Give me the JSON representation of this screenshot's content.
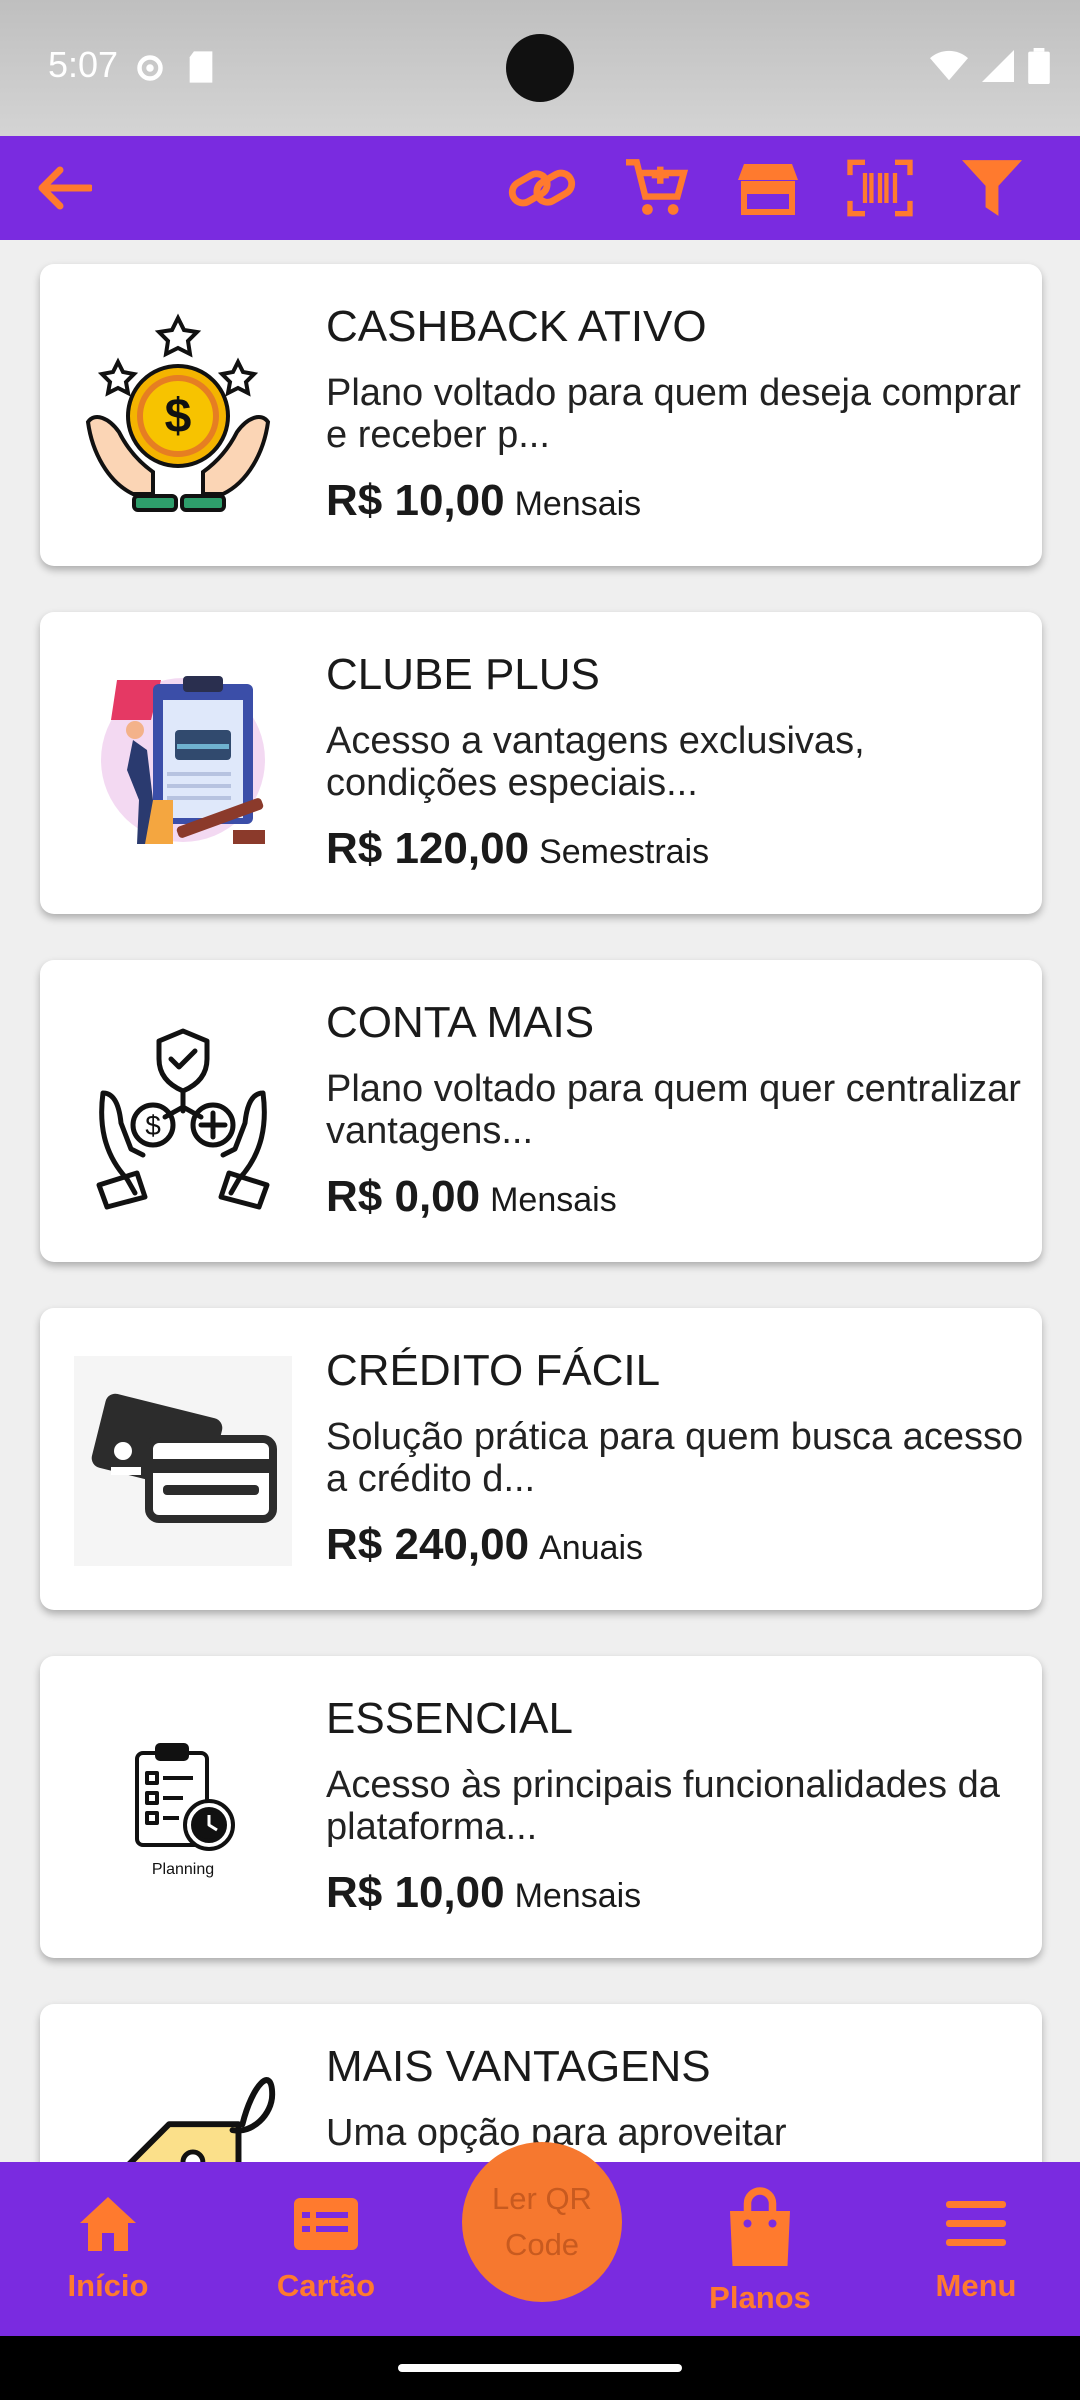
{
  "status_bar": {
    "time": "5:07"
  },
  "toolbar": {
    "back": "back-arrow-icon",
    "actions": [
      "link-icon",
      "cart-add-icon",
      "store-icon",
      "barcode-scan-icon",
      "filter-icon"
    ]
  },
  "plans": [
    {
      "title": "CASHBACK ATIVO",
      "description": "Plano voltado para quem deseja comprar e receber p...",
      "price": "R$ 10,00",
      "period": "Mensais",
      "icon": "cashback-coin-icon"
    },
    {
      "title": "CLUBE PLUS",
      "description": "Acesso a vantagens exclusivas, condições especiais...",
      "price": "R$ 120,00",
      "period": "Semestrais",
      "icon": "club-illustration-icon"
    },
    {
      "title": "CONTA MAIS",
      "description": "Plano voltado para quem quer centralizar vantagens...",
      "price": "R$ 0,00",
      "period": "Mensais",
      "icon": "hands-shield-icon"
    },
    {
      "title": "CRÉDITO FÁCIL",
      "description": "Solução prática para quem busca acesso a crédito d...",
      "price": "R$ 240,00",
      "period": "Anuais",
      "icon": "credit-cards-icon"
    },
    {
      "title": "ESSENCIAL",
      "description": "Acesso às principais funcionalidades da plataforma...",
      "price": "R$ 10,00",
      "period": "Mensais",
      "icon": "planning-clipboard-icon",
      "icon_caption": "Planning"
    },
    {
      "title": "MAIS VANTAGENS",
      "description": "Uma opção para aproveitar",
      "price": "",
      "period": "",
      "icon": "price-tag-icon"
    }
  ],
  "bottom_nav": {
    "items": [
      {
        "label": "Início",
        "icon": "home-icon"
      },
      {
        "label": "Cartão",
        "icon": "card-icon"
      },
      {
        "label": "Planos",
        "icon": "shopping-bag-icon"
      },
      {
        "label": "Menu",
        "icon": "menu-icon"
      }
    ],
    "qr_button": {
      "line1": "Ler QR",
      "line2": "Code"
    }
  },
  "colors": {
    "primary": "#7a2be0",
    "accent": "#ff7a2e"
  }
}
